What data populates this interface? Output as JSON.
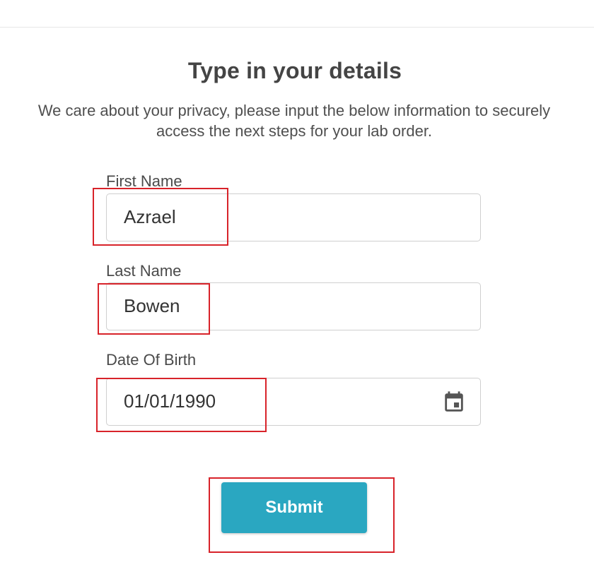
{
  "header": {
    "title": "Type in your details",
    "subtitle": "We care about your privacy, please input the below information to securely access the next steps for your lab order."
  },
  "form": {
    "first_name": {
      "label": "First Name",
      "value": "Azrael"
    },
    "last_name": {
      "label": "Last Name",
      "value": "Bowen"
    },
    "date_of_birth": {
      "label": "Date Of Birth",
      "value": "01/01/1990",
      "icon": "calendar-icon"
    },
    "submit_label": "Submit"
  },
  "colors": {
    "accent": "#2aa7c1",
    "highlight": "#d8232a"
  }
}
